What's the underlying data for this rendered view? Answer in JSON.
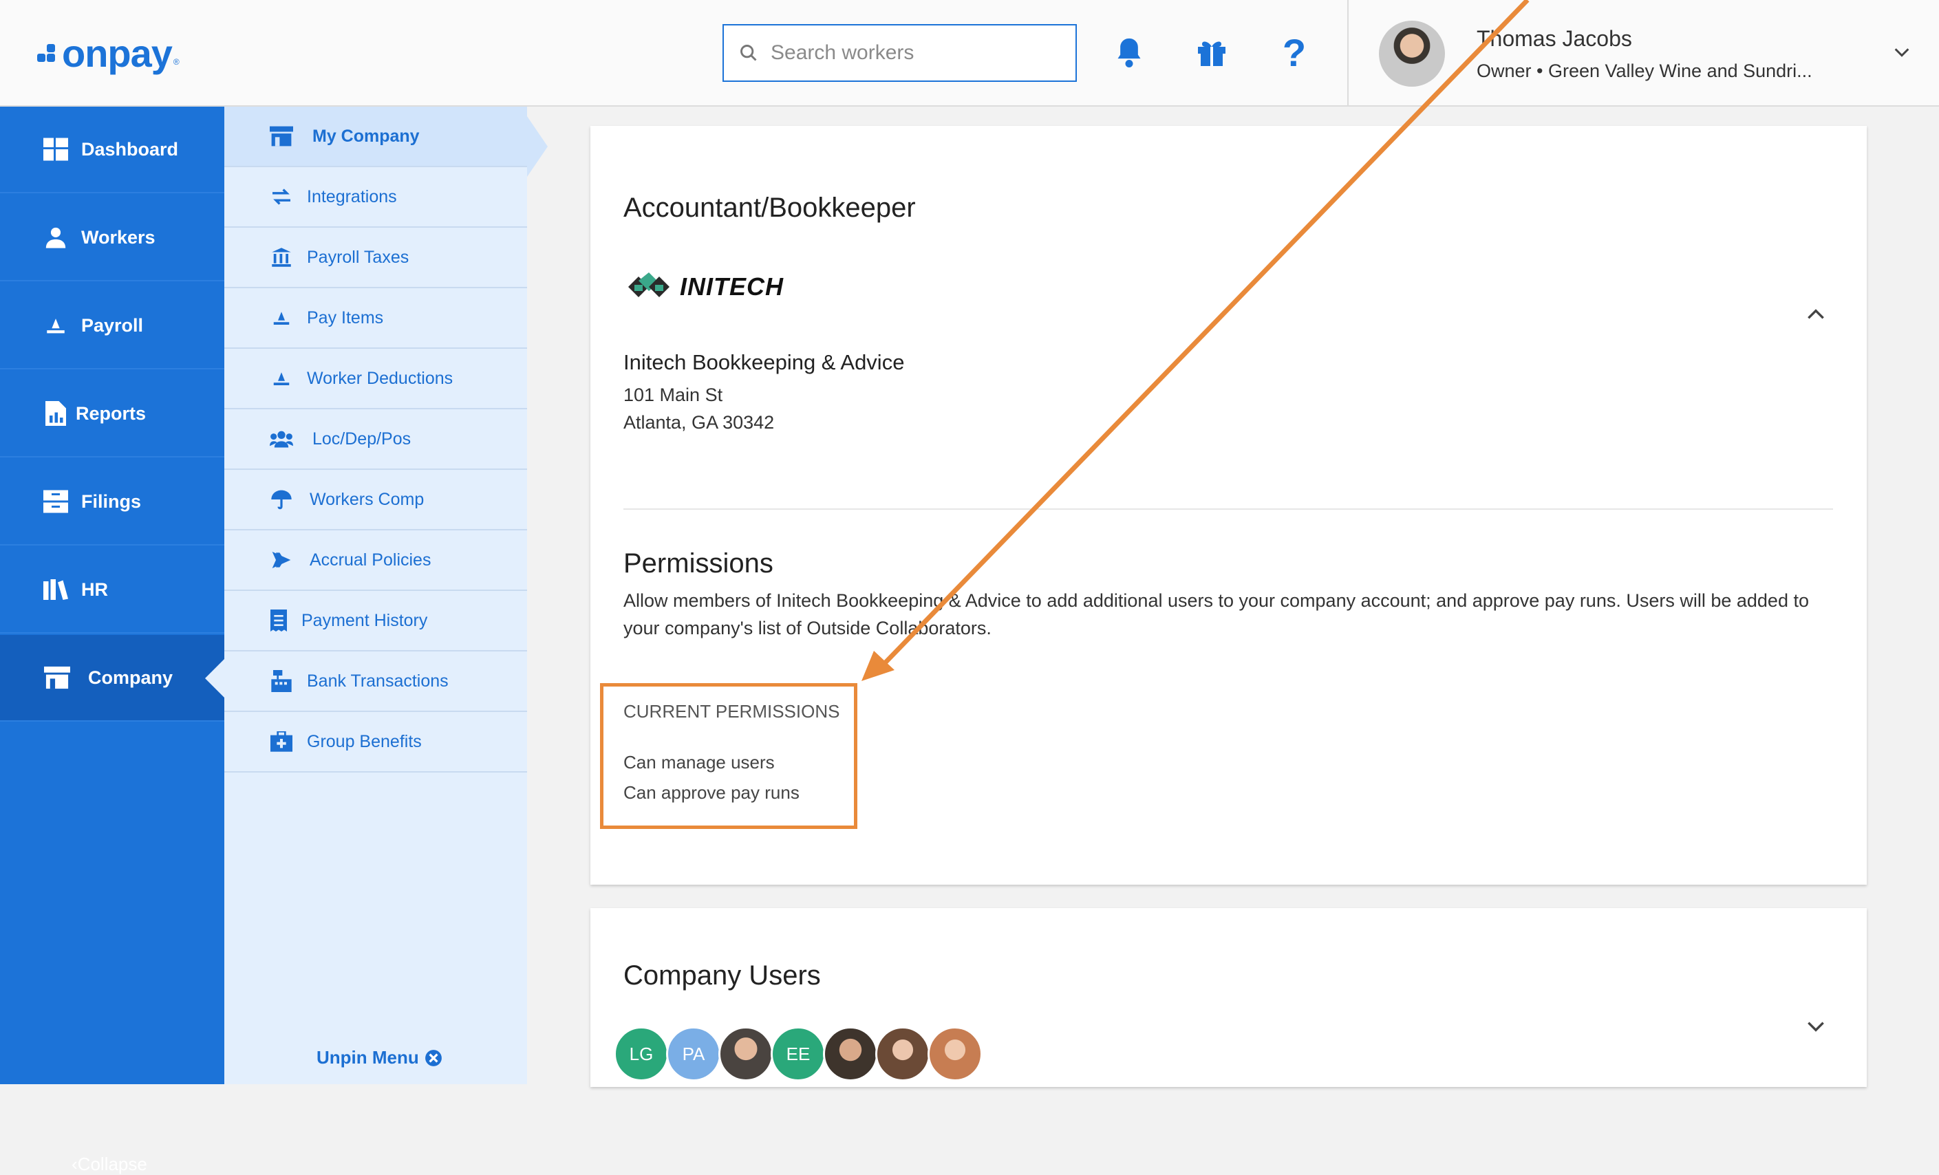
{
  "header": {
    "logo_text": "onpay",
    "search_placeholder": "Search workers",
    "icons": [
      "bell-icon",
      "gift-icon",
      "help-icon"
    ],
    "user": {
      "name": "Thomas Jacobs",
      "role": "Owner • Green Valley Wine and Sundri..."
    }
  },
  "nav": {
    "items": [
      {
        "label": "Dashboard",
        "icon": "dashboard-icon"
      },
      {
        "label": "Workers",
        "icon": "workers-icon"
      },
      {
        "label": "Payroll",
        "icon": "payroll-icon"
      },
      {
        "label": "Reports",
        "icon": "reports-icon"
      },
      {
        "label": "Filings",
        "icon": "filings-icon"
      },
      {
        "label": "HR",
        "icon": "hr-icon"
      },
      {
        "label": "Company",
        "icon": "company-icon",
        "active": true
      }
    ],
    "collapse_label": "Collapse"
  },
  "subnav": {
    "items": [
      {
        "label": "My Company",
        "active": true
      },
      {
        "label": "Integrations"
      },
      {
        "label": "Payroll Taxes"
      },
      {
        "label": "Pay Items"
      },
      {
        "label": "Worker Deductions"
      },
      {
        "label": "Loc/Dep/Pos"
      },
      {
        "label": "Workers Comp"
      },
      {
        "label": "Accrual Policies"
      },
      {
        "label": "Payment History"
      },
      {
        "label": "Bank Transactions"
      },
      {
        "label": "Group Benefits"
      }
    ],
    "unpin_label": "Unpin Menu"
  },
  "accountant": {
    "title": "Accountant/Bookkeeper",
    "logo_text": "INITECH",
    "company_name": "Initech Bookkeeping & Advice",
    "address_line1": "101 Main St",
    "address_line2": "Atlanta, GA 30342"
  },
  "permissions": {
    "title": "Permissions",
    "description": "Allow members of Initech Bookkeeping & Advice to add additional users to your company account; and approve pay runs. Users will be added to your company's list of Outside Collaborators.",
    "current_heading": "CURRENT PERMISSIONS",
    "items": [
      "Can manage users",
      "Can approve pay runs"
    ]
  },
  "company_users": {
    "title": "Company Users",
    "avatars": [
      {
        "initials": "LG",
        "color": "#2aa87a"
      },
      {
        "initials": "PA",
        "color": "#7aaee6"
      },
      {
        "initials": "",
        "color": "#6d6a66"
      },
      {
        "initials": "EE",
        "color": "#2aa87a"
      },
      {
        "initials": "",
        "color": "#5a4a3e"
      },
      {
        "initials": "",
        "color": "#8a6a5a"
      },
      {
        "initials": "",
        "color": "#c48a6a"
      }
    ]
  },
  "colors": {
    "brand": "#1c73d8",
    "nav_active": "#145fbd",
    "subnav_bg": "#e3effd",
    "annotation": "#e98a3a"
  }
}
